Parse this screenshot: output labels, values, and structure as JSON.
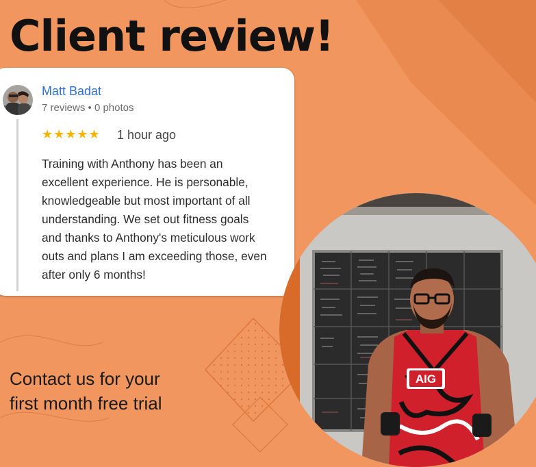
{
  "headline": "Client review!",
  "review": {
    "reviewer_name": "Matt Badat",
    "reviewer_meta": "7 reviews • 0 photos",
    "stars": "★★★★★",
    "rating": 5,
    "time_ago": "1 hour ago",
    "text": "Training with Anthony has been an\nexcellent experience. He is personable,\nknowledgeable but most important of all\nunderstanding. We set out fitness goals\nand thanks to Anthony's meticulous work\nouts and plans I am exceeding those, even\nafter only 6 months!"
  },
  "cta": "Contact us for your\nfirst month free trial",
  "jersey_logo": "AIG",
  "colors": {
    "background": "#F0965E",
    "headline": "#111111",
    "reviewer_name": "#2F6FD6",
    "stars": "#F4B400",
    "jersey_red": "#D0202C"
  }
}
